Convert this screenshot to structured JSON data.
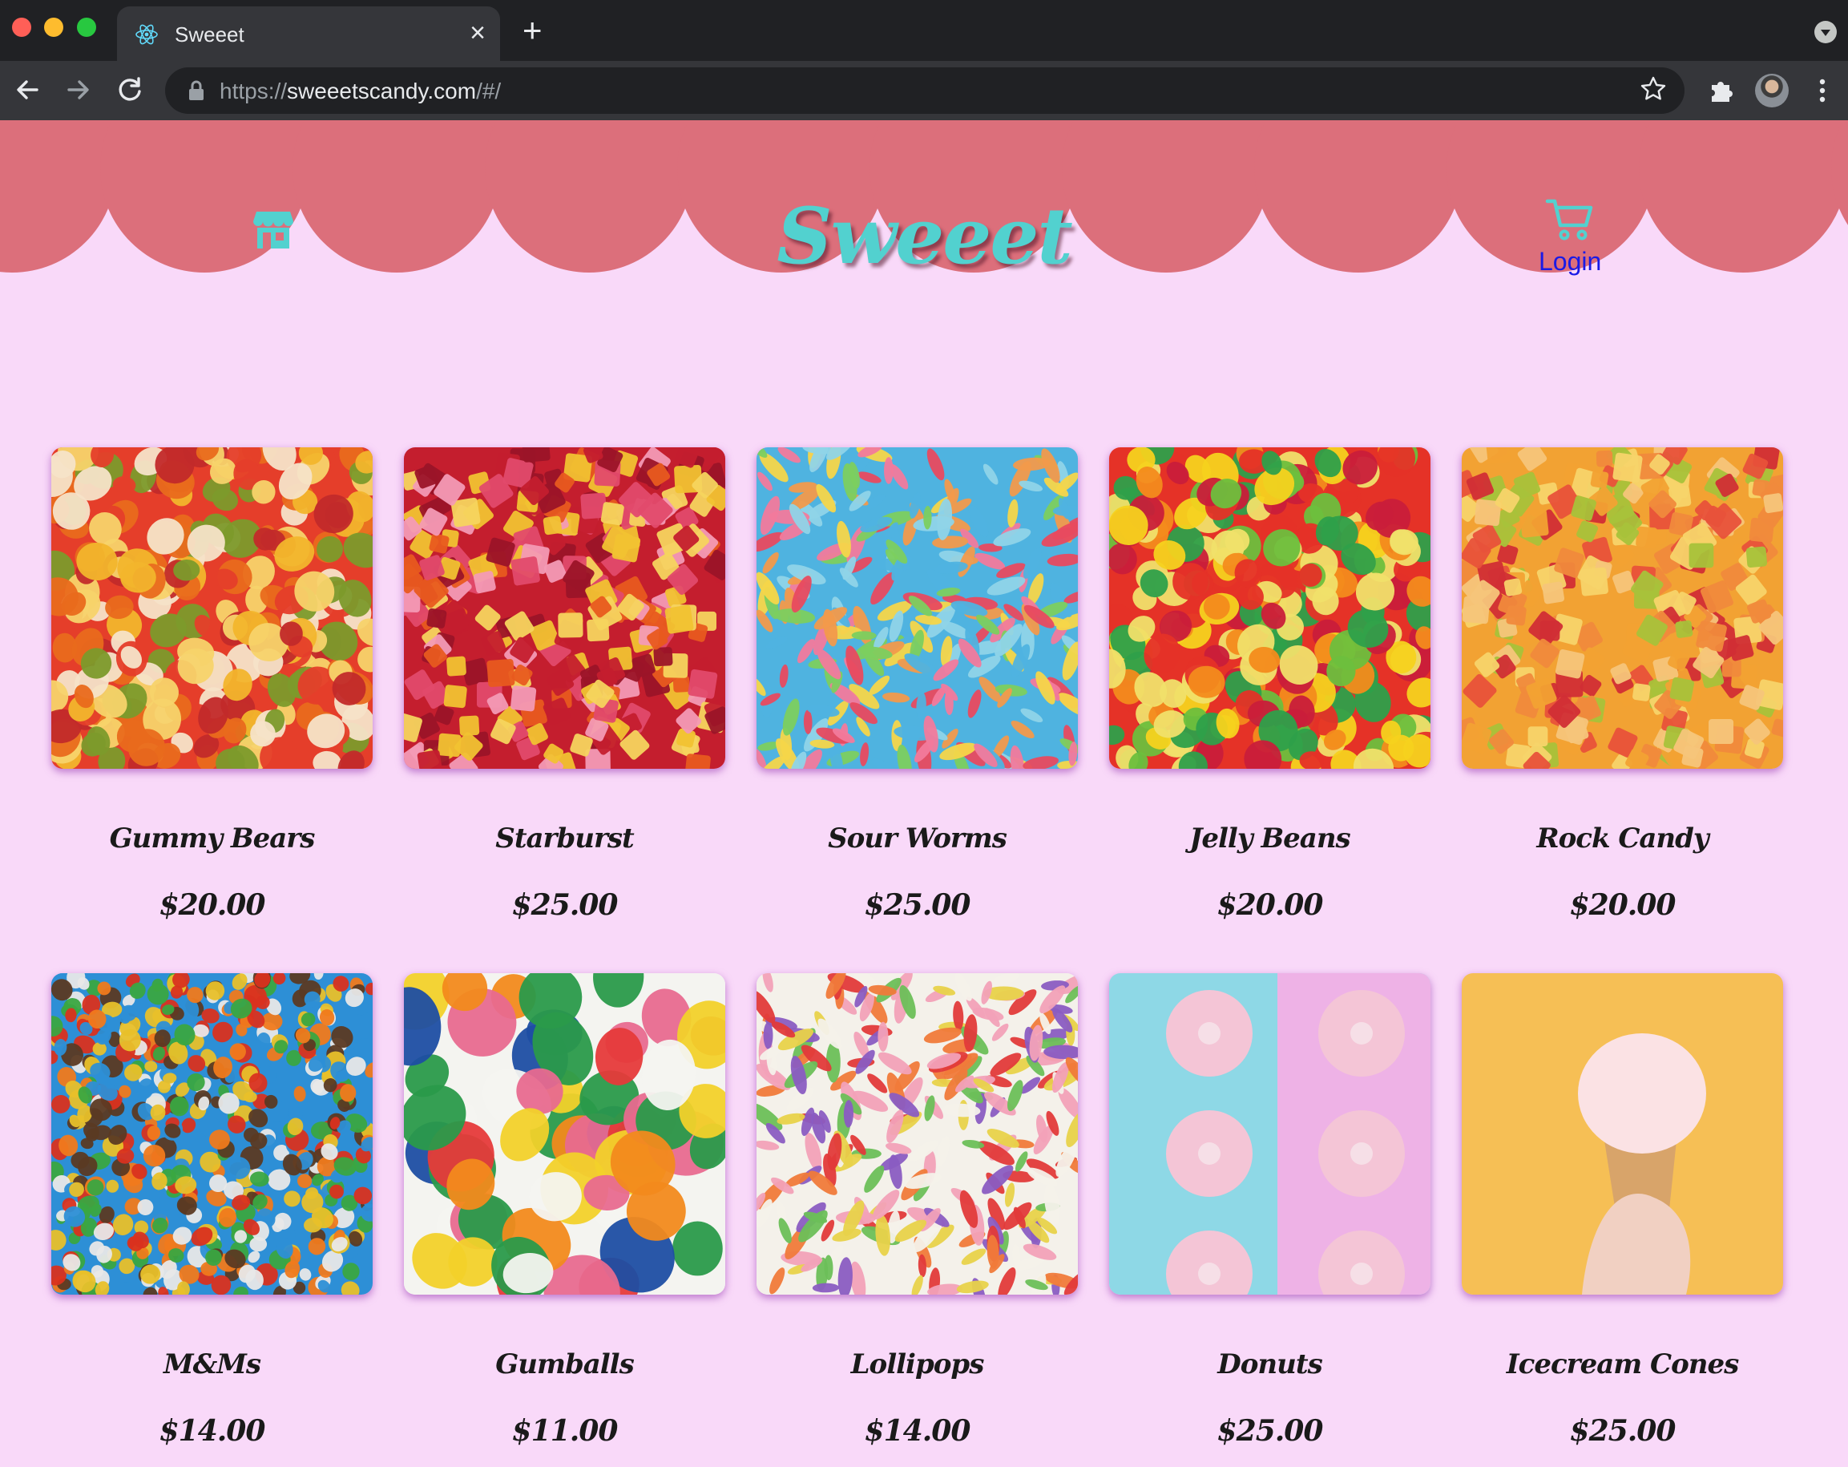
{
  "browser": {
    "tab_title": "Sweeet",
    "tab_close": "×",
    "new_tab": "+",
    "url_scheme": "https://",
    "url_host": "sweeetscandy.com",
    "url_path": "/#/",
    "icons": [
      "react-icon",
      "close-icon",
      "plus-icon",
      "back-arrow-icon",
      "forward-arrow-icon",
      "reload-icon",
      "lock-icon",
      "star-icon",
      "puzzle-icon",
      "avatar",
      "more-vert-icon"
    ]
  },
  "header": {
    "brand": "Sweeet",
    "login_label": "Login",
    "colors": {
      "band": "#dc6f7b",
      "brand": "#52d1cf",
      "icon": "#52d1cf",
      "login": "#1a1ae6",
      "page_bg": "#f9d9f9"
    },
    "icons": [
      "store-icon",
      "cart-icon"
    ]
  },
  "products": [
    {
      "name": "Gummy Bears",
      "price": "$20.00",
      "palette": [
        "#e53e2a",
        "#f2b52c",
        "#f6e3c8",
        "#c22a2a",
        "#7c9a2b",
        "#f7d36a",
        "#e96a1c"
      ]
    },
    {
      "name": "Starburst",
      "price": "$25.00",
      "palette": [
        "#c41e2e",
        "#e24a6b",
        "#f1c231",
        "#e85a1f",
        "#f39ab5",
        "#9b1428",
        "#f6d45e"
      ]
    },
    {
      "name": "Sour Worms",
      "price": "$25.00",
      "palette": [
        "#4fb3e0",
        "#f27a9c",
        "#f5d649",
        "#7ccf5f",
        "#f29a4b",
        "#8fd4e8",
        "#e84a5f"
      ]
    },
    {
      "name": "Jelly Beans",
      "price": "$20.00",
      "palette": [
        "#e53227",
        "#f5d21e",
        "#2ea04a",
        "#f38b1c",
        "#c91d3a",
        "#f0e06a",
        "#6dbf3d"
      ]
    },
    {
      "name": "Rock Candy",
      "price": "$20.00",
      "palette": [
        "#f2a233",
        "#e8523a",
        "#f7d46a",
        "#d12e35",
        "#f6c57a",
        "#a8c23a",
        "#f08a3c"
      ]
    },
    {
      "name": "M&Ms",
      "price": "$14.00",
      "palette": [
        "#2d8fd6",
        "#e8c02a",
        "#3aa641",
        "#d9321f",
        "#f07a1c",
        "#5b3a23",
        "#e8e8e8"
      ]
    },
    {
      "name": "Gumballs",
      "price": "$11.00",
      "palette": [
        "#f4f4f0",
        "#1e4ea3",
        "#e63a3a",
        "#f2d12a",
        "#f28a1c",
        "#e86a8f",
        "#2a9a4a"
      ]
    },
    {
      "name": "Lollipops",
      "price": "$14.00",
      "palette": [
        "#f4f1ea",
        "#e23a3a",
        "#f2a1b8",
        "#e8d24a",
        "#6bbf59",
        "#8a5cc2",
        "#f07a3a"
      ]
    },
    {
      "name": "Donuts",
      "price": "$25.00",
      "palette": [
        "#f4b8cf",
        "#fbe9f0",
        "#f6c9a4",
        "#ffffff",
        "#f28fb0",
        "#d49a6a",
        "#f6dfe7"
      ]
    },
    {
      "name": "Icecream Cones",
      "price": "$25.00",
      "palette": [
        "#fbe2e4",
        "#f4c9cf",
        "#e7b77a",
        "#f3dcd5",
        "#f1c8c0",
        "#d8a46a",
        "#ffffff"
      ]
    }
  ]
}
